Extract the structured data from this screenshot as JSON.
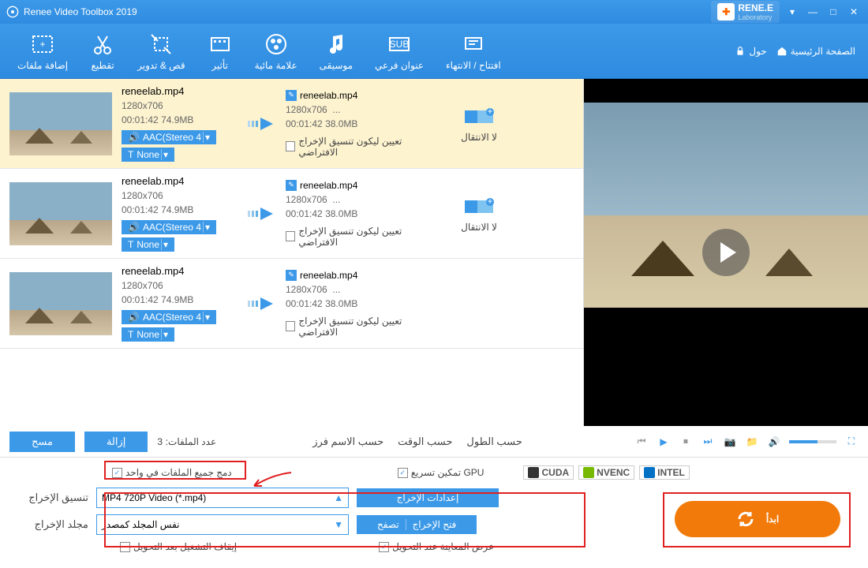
{
  "title": "Renee Video Toolbox 2019",
  "brand": {
    "name": "RENE.E",
    "sub": "Laboratory"
  },
  "nav": {
    "home": "الصفحة الرئيسية",
    "about": "حول"
  },
  "tools": [
    {
      "label": "إضافة ملفات"
    },
    {
      "label": "تقطيع"
    },
    {
      "label": "قص & تدوير"
    },
    {
      "label": "تأثير"
    },
    {
      "label": "علامة مائية"
    },
    {
      "label": "موسيقى"
    },
    {
      "label": "عنوان فرعي"
    },
    {
      "label": "افتتاح / الانتهاء"
    }
  ],
  "file": {
    "name": "reneelab.mp4",
    "res": "1280x706",
    "dur": "00:01:42",
    "size_in": "74.9MB",
    "size_out": "38.0MB",
    "dots": "...",
    "audio": "AAC(Stereo 4",
    "text": "None",
    "default_fmt": "تعيين ليكون تنسيق الإخراج الافتراضي",
    "no_trans": "لا الانتقال"
  },
  "controls": {
    "clear": "مسح",
    "remove": "إزالة",
    "count_label": "عدد الملفات:",
    "count": "3",
    "sort_len": "حسب الطول",
    "sort_time": "حسب الوقت",
    "sort_name": "حسب الاسم فرز"
  },
  "opts": {
    "merge": "دمج جميع الملفات في واحد",
    "gpu": "GPU تمكين تسريع",
    "cuda": "CUDA",
    "nvenc": "NVENC",
    "intel": "INTEL",
    "out_fmt_label": "تنسيق الإخراج",
    "out_fmt": "MP4 720P Video (*.mp4)",
    "out_settings": "إعدادات الإخراج",
    "out_folder_label": "مجلد الإخراج",
    "out_folder": "نفس المجلد كمصدر",
    "browse": "تصفح",
    "open_out": "فتح الإخراج",
    "stop_after": "إيقاف التشغيل بعد التحويل",
    "preview_after": "عرض المعاينة عند التحويل",
    "start": "ابدأ"
  }
}
